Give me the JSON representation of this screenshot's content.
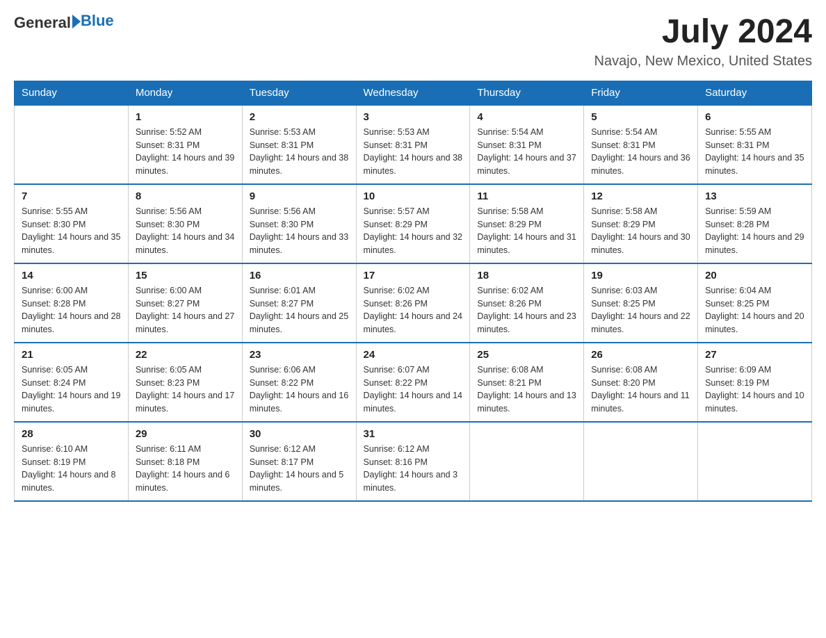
{
  "header": {
    "logo_text": "General",
    "logo_blue": "Blue",
    "month_title": "July 2024",
    "location": "Navajo, New Mexico, United States"
  },
  "weekdays": [
    "Sunday",
    "Monday",
    "Tuesday",
    "Wednesday",
    "Thursday",
    "Friday",
    "Saturday"
  ],
  "weeks": [
    [
      {
        "day": "",
        "sunrise": "",
        "sunset": "",
        "daylight": ""
      },
      {
        "day": "1",
        "sunrise": "Sunrise: 5:52 AM",
        "sunset": "Sunset: 8:31 PM",
        "daylight": "Daylight: 14 hours and 39 minutes."
      },
      {
        "day": "2",
        "sunrise": "Sunrise: 5:53 AM",
        "sunset": "Sunset: 8:31 PM",
        "daylight": "Daylight: 14 hours and 38 minutes."
      },
      {
        "day": "3",
        "sunrise": "Sunrise: 5:53 AM",
        "sunset": "Sunset: 8:31 PM",
        "daylight": "Daylight: 14 hours and 38 minutes."
      },
      {
        "day": "4",
        "sunrise": "Sunrise: 5:54 AM",
        "sunset": "Sunset: 8:31 PM",
        "daylight": "Daylight: 14 hours and 37 minutes."
      },
      {
        "day": "5",
        "sunrise": "Sunrise: 5:54 AM",
        "sunset": "Sunset: 8:31 PM",
        "daylight": "Daylight: 14 hours and 36 minutes."
      },
      {
        "day": "6",
        "sunrise": "Sunrise: 5:55 AM",
        "sunset": "Sunset: 8:31 PM",
        "daylight": "Daylight: 14 hours and 35 minutes."
      }
    ],
    [
      {
        "day": "7",
        "sunrise": "Sunrise: 5:55 AM",
        "sunset": "Sunset: 8:30 PM",
        "daylight": "Daylight: 14 hours and 35 minutes."
      },
      {
        "day": "8",
        "sunrise": "Sunrise: 5:56 AM",
        "sunset": "Sunset: 8:30 PM",
        "daylight": "Daylight: 14 hours and 34 minutes."
      },
      {
        "day": "9",
        "sunrise": "Sunrise: 5:56 AM",
        "sunset": "Sunset: 8:30 PM",
        "daylight": "Daylight: 14 hours and 33 minutes."
      },
      {
        "day": "10",
        "sunrise": "Sunrise: 5:57 AM",
        "sunset": "Sunset: 8:29 PM",
        "daylight": "Daylight: 14 hours and 32 minutes."
      },
      {
        "day": "11",
        "sunrise": "Sunrise: 5:58 AM",
        "sunset": "Sunset: 8:29 PM",
        "daylight": "Daylight: 14 hours and 31 minutes."
      },
      {
        "day": "12",
        "sunrise": "Sunrise: 5:58 AM",
        "sunset": "Sunset: 8:29 PM",
        "daylight": "Daylight: 14 hours and 30 minutes."
      },
      {
        "day": "13",
        "sunrise": "Sunrise: 5:59 AM",
        "sunset": "Sunset: 8:28 PM",
        "daylight": "Daylight: 14 hours and 29 minutes."
      }
    ],
    [
      {
        "day": "14",
        "sunrise": "Sunrise: 6:00 AM",
        "sunset": "Sunset: 8:28 PM",
        "daylight": "Daylight: 14 hours and 28 minutes."
      },
      {
        "day": "15",
        "sunrise": "Sunrise: 6:00 AM",
        "sunset": "Sunset: 8:27 PM",
        "daylight": "Daylight: 14 hours and 27 minutes."
      },
      {
        "day": "16",
        "sunrise": "Sunrise: 6:01 AM",
        "sunset": "Sunset: 8:27 PM",
        "daylight": "Daylight: 14 hours and 25 minutes."
      },
      {
        "day": "17",
        "sunrise": "Sunrise: 6:02 AM",
        "sunset": "Sunset: 8:26 PM",
        "daylight": "Daylight: 14 hours and 24 minutes."
      },
      {
        "day": "18",
        "sunrise": "Sunrise: 6:02 AM",
        "sunset": "Sunset: 8:26 PM",
        "daylight": "Daylight: 14 hours and 23 minutes."
      },
      {
        "day": "19",
        "sunrise": "Sunrise: 6:03 AM",
        "sunset": "Sunset: 8:25 PM",
        "daylight": "Daylight: 14 hours and 22 minutes."
      },
      {
        "day": "20",
        "sunrise": "Sunrise: 6:04 AM",
        "sunset": "Sunset: 8:25 PM",
        "daylight": "Daylight: 14 hours and 20 minutes."
      }
    ],
    [
      {
        "day": "21",
        "sunrise": "Sunrise: 6:05 AM",
        "sunset": "Sunset: 8:24 PM",
        "daylight": "Daylight: 14 hours and 19 minutes."
      },
      {
        "day": "22",
        "sunrise": "Sunrise: 6:05 AM",
        "sunset": "Sunset: 8:23 PM",
        "daylight": "Daylight: 14 hours and 17 minutes."
      },
      {
        "day": "23",
        "sunrise": "Sunrise: 6:06 AM",
        "sunset": "Sunset: 8:22 PM",
        "daylight": "Daylight: 14 hours and 16 minutes."
      },
      {
        "day": "24",
        "sunrise": "Sunrise: 6:07 AM",
        "sunset": "Sunset: 8:22 PM",
        "daylight": "Daylight: 14 hours and 14 minutes."
      },
      {
        "day": "25",
        "sunrise": "Sunrise: 6:08 AM",
        "sunset": "Sunset: 8:21 PM",
        "daylight": "Daylight: 14 hours and 13 minutes."
      },
      {
        "day": "26",
        "sunrise": "Sunrise: 6:08 AM",
        "sunset": "Sunset: 8:20 PM",
        "daylight": "Daylight: 14 hours and 11 minutes."
      },
      {
        "day": "27",
        "sunrise": "Sunrise: 6:09 AM",
        "sunset": "Sunset: 8:19 PM",
        "daylight": "Daylight: 14 hours and 10 minutes."
      }
    ],
    [
      {
        "day": "28",
        "sunrise": "Sunrise: 6:10 AM",
        "sunset": "Sunset: 8:19 PM",
        "daylight": "Daylight: 14 hours and 8 minutes."
      },
      {
        "day": "29",
        "sunrise": "Sunrise: 6:11 AM",
        "sunset": "Sunset: 8:18 PM",
        "daylight": "Daylight: 14 hours and 6 minutes."
      },
      {
        "day": "30",
        "sunrise": "Sunrise: 6:12 AM",
        "sunset": "Sunset: 8:17 PM",
        "daylight": "Daylight: 14 hours and 5 minutes."
      },
      {
        "day": "31",
        "sunrise": "Sunrise: 6:12 AM",
        "sunset": "Sunset: 8:16 PM",
        "daylight": "Daylight: 14 hours and 3 minutes."
      },
      {
        "day": "",
        "sunrise": "",
        "sunset": "",
        "daylight": ""
      },
      {
        "day": "",
        "sunrise": "",
        "sunset": "",
        "daylight": ""
      },
      {
        "day": "",
        "sunrise": "",
        "sunset": "",
        "daylight": ""
      }
    ]
  ]
}
